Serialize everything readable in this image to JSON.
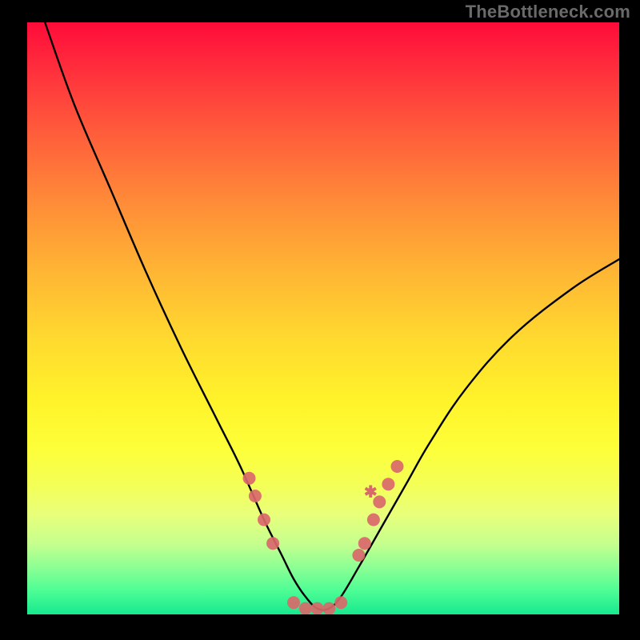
{
  "watermark": "TheBottleneck.com",
  "chart_data": {
    "type": "line",
    "title": "",
    "xlabel": "",
    "ylabel": "",
    "ylim": [
      0,
      100
    ],
    "xlim": [
      0,
      100
    ],
    "series": [
      {
        "name": "bottleneck-curve",
        "x": [
          3,
          8,
          14,
          20,
          26,
          32,
          36,
          40,
          43,
          45,
          47,
          49,
          51,
          53,
          56,
          60,
          64,
          68,
          74,
          82,
          92,
          100
        ],
        "y": [
          100,
          86,
          72,
          58,
          45,
          33,
          25,
          16,
          10,
          6,
          3,
          1,
          1,
          3,
          8,
          15,
          22,
          29,
          38,
          47,
          55,
          60
        ]
      }
    ],
    "markers": {
      "name": "highlight-dots",
      "color": "#d9686a",
      "x": [
        37.5,
        38.5,
        40.0,
        41.5,
        45.0,
        47.0,
        49.0,
        51.0,
        53.0,
        56.0,
        57.0,
        58.5,
        59.5,
        61.0,
        62.5
      ],
      "y": [
        23.0,
        20.0,
        16.0,
        12.0,
        2.0,
        1.0,
        1.0,
        1.0,
        2.0,
        10.0,
        12.0,
        16.0,
        19.0,
        22.0,
        25.0
      ]
    },
    "annotations": [
      {
        "x": 58.0,
        "y": 20.5,
        "text": "✱",
        "color": "#d9686a"
      }
    ]
  }
}
